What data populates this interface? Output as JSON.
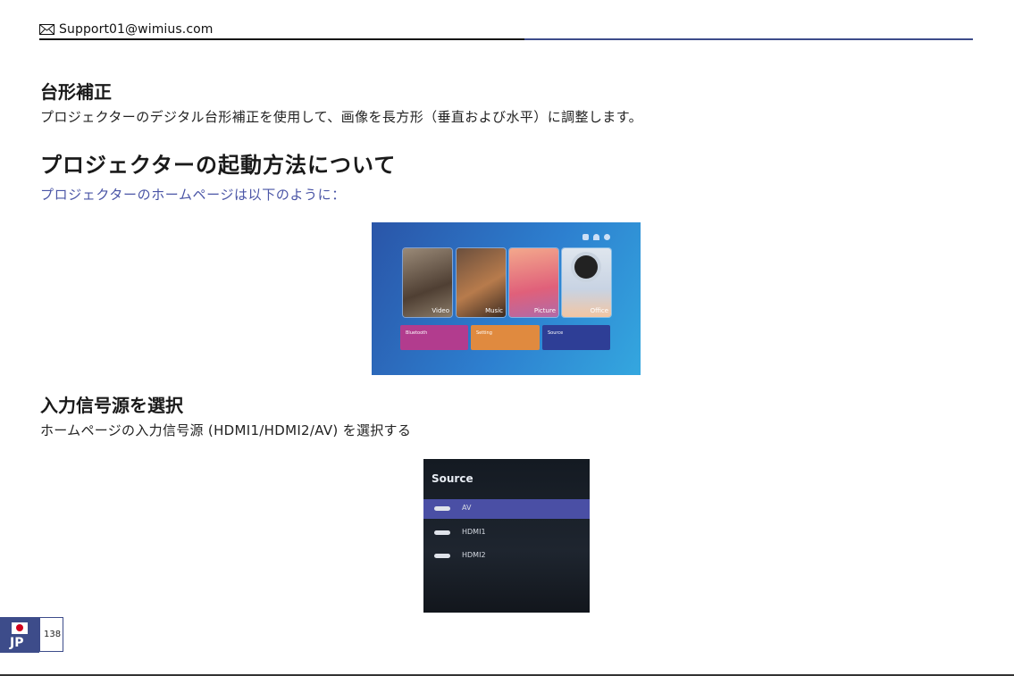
{
  "header": {
    "email": "Support01@wimius.com",
    "mail_icon": "envelope-icon"
  },
  "sections": {
    "keystone": {
      "heading": "台形補正",
      "text": "プロジェクターのデジタル台形補正を使用して、画像を長方形（垂直および水平）に調整します。"
    },
    "startup": {
      "heading": "プロジェクターの起動方法について",
      "subtitle": "プロジェクターのホームページは以下のように："
    },
    "source": {
      "heading": "入力信号源を選択",
      "text": "ホームページの入力信号源 (HDMI1/HDMI2/AV) を選択する"
    }
  },
  "home_screen": {
    "cards": [
      "Video",
      "Music",
      "Picture",
      "Office"
    ],
    "tiles": [
      "Bluetooth",
      "Setting",
      "Source"
    ]
  },
  "source_menu": {
    "title": "Source",
    "items": [
      "AV",
      "HDMI1",
      "HDMI2"
    ]
  },
  "footer": {
    "lang": "JP",
    "page": "138"
  },
  "colors": {
    "accent": "#3d4c8a",
    "subtitle": "#4a55a6",
    "highlight": "#4a4fa5"
  }
}
